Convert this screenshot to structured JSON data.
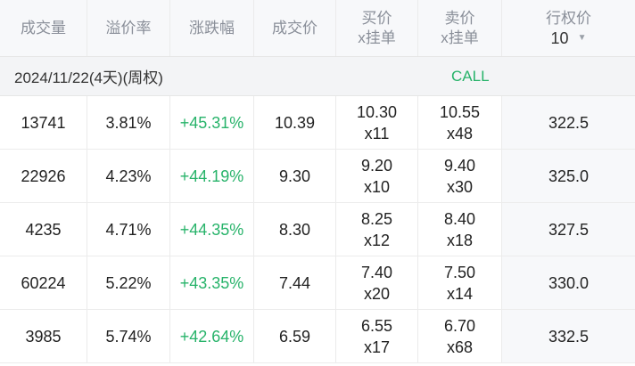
{
  "header": {
    "volume": "成交量",
    "premium": "溢价率",
    "change": "涨跌幅",
    "last": "成交价",
    "bid_1": "买价",
    "bid_2": "x挂单",
    "ask_1": "卖价",
    "ask_2": "x挂单",
    "strike_label": "行权价",
    "strike_count": "10"
  },
  "expiry": {
    "date": "2024/11/22(4天)(周权)",
    "type": "CALL"
  },
  "colors": {
    "positive": "#27b36a",
    "header_text": "#8a8f99"
  },
  "rows": [
    {
      "volume": "13741",
      "premium": "3.81%",
      "change": "+45.31%",
      "last": "10.39",
      "bid": "10.30",
      "bid_size": "x11",
      "ask": "10.55",
      "ask_size": "x48",
      "strike": "322.5"
    },
    {
      "volume": "22926",
      "premium": "4.23%",
      "change": "+44.19%",
      "last": "9.30",
      "bid": "9.20",
      "bid_size": "x10",
      "ask": "9.40",
      "ask_size": "x30",
      "strike": "325.0"
    },
    {
      "volume": "4235",
      "premium": "4.71%",
      "change": "+44.35%",
      "last": "8.30",
      "bid": "8.25",
      "bid_size": "x12",
      "ask": "8.40",
      "ask_size": "x18",
      "strike": "327.5"
    },
    {
      "volume": "60224",
      "premium": "5.22%",
      "change": "+43.35%",
      "last": "7.44",
      "bid": "7.40",
      "bid_size": "x20",
      "ask": "7.50",
      "ask_size": "x14",
      "strike": "330.0"
    },
    {
      "volume": "3985",
      "premium": "5.74%",
      "change": "+42.64%",
      "last": "6.59",
      "bid": "6.55",
      "bid_size": "x17",
      "ask": "6.70",
      "ask_size": "x68",
      "strike": "332.5"
    }
  ]
}
